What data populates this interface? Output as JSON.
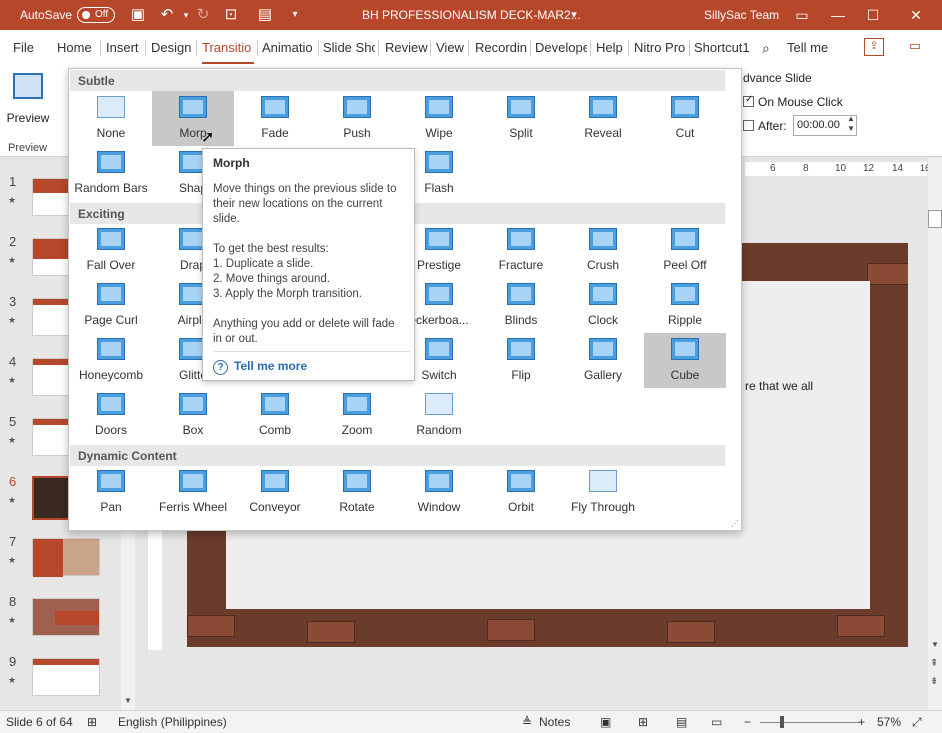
{
  "titlebar": {
    "autosave_label": "AutoSave",
    "autosave_state": "Off",
    "document_title": "BH PROFESSIONALISM DECK-MAR2...",
    "user": "SillySac Team",
    "accent_color": "#b7472a"
  },
  "tabs": [
    "File",
    "Home",
    "Insert",
    "Design",
    "Transitio",
    "Animatio",
    "Slide Sho",
    "Review",
    "View",
    "Recordin",
    "Develope",
    "Help",
    "Nitro Pro",
    "Shortcut1"
  ],
  "active_tab": "Transitio",
  "tell_me": "Tell me",
  "ribbon": {
    "preview_label": "Preview",
    "preview_group": "Preview",
    "advance_slide": "dvance Slide",
    "on_mouse_click": "On Mouse Click",
    "after": "After:",
    "after_value": "00:00.00"
  },
  "gallery": {
    "subtle_header": "Subtle",
    "exciting_header": "Exciting",
    "dynamic_header": "Dynamic Content",
    "subtle": [
      "None",
      "Morph",
      "Fade",
      "Push",
      "Wipe",
      "Split",
      "Reveal",
      "Cut",
      "Random Bars",
      "Shape",
      "Flash"
    ],
    "exciting": [
      "Fall Over",
      "Drape",
      "Prestige",
      "Fracture",
      "Crush",
      "Peel Off",
      "Page Curl",
      "Airplane",
      "eckerboa...",
      "Blinds",
      "Clock",
      "Ripple",
      "Honeycomb",
      "Glitter",
      "Switch",
      "Flip",
      "Gallery",
      "Cube",
      "Doors",
      "Box",
      "Comb",
      "Zoom",
      "Random"
    ],
    "dynamic": [
      "Pan",
      "Ferris Wheel",
      "Conveyor",
      "Rotate",
      "Window",
      "Orbit",
      "Fly Through"
    ],
    "visible_labels": {
      "morph": "Morp",
      "shape": "Shap",
      "drape": "Drap",
      "airplane": "Airpla",
      "glitter": "Glitte"
    }
  },
  "tooltip": {
    "title": "Morph",
    "description": "Move things on the previous slide to their new locations on the current slide.",
    "tips_heading": "To get the best results:",
    "tip1": "1. Duplicate a slide.",
    "tip2": "2. Move things around.",
    "tip3": "3. Apply the Morph transition.",
    "note": "Anything you add or delete will fade in or out.",
    "tell_more": "Tell me more"
  },
  "slides": {
    "numbers": [
      "1",
      "2",
      "3",
      "4",
      "5",
      "6",
      "7",
      "8",
      "9"
    ],
    "selected": "6"
  },
  "slide_fragment": "re that we all",
  "ruler": [
    "6",
    "8",
    "10",
    "12",
    "14",
    "16"
  ],
  "status": {
    "slide_info": "Slide 6 of 64",
    "language": "English (Philippines)",
    "notes": "Notes",
    "zoom": "57%"
  }
}
